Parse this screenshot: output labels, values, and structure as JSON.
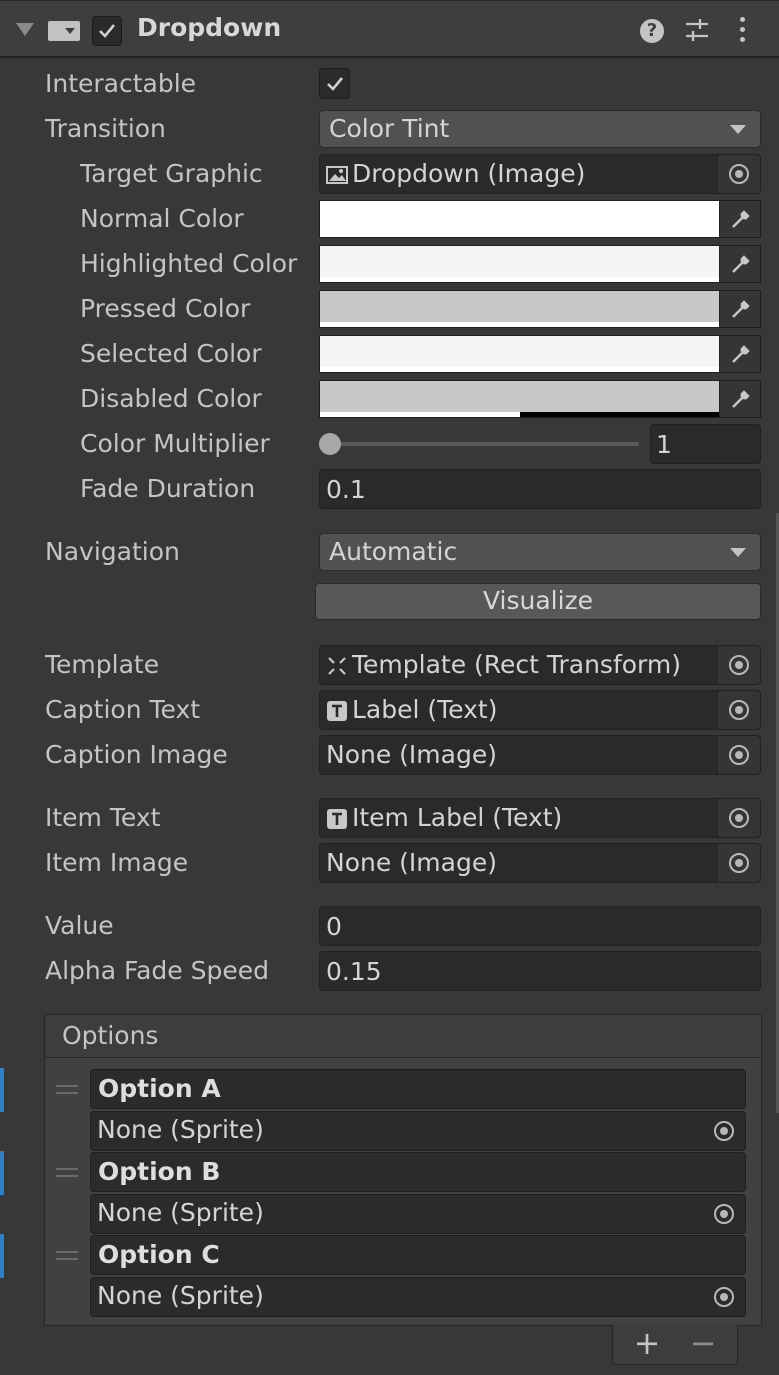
{
  "component": {
    "title": "Dropdown",
    "enabled": true,
    "help_glyph": "?"
  },
  "fields": {
    "interactable": {
      "label": "Interactable",
      "checked": true
    },
    "transition": {
      "label": "Transition",
      "value": "Color Tint"
    },
    "target_graphic": {
      "label": "Target Graphic",
      "value": "Dropdown (Image)"
    },
    "normal_color": {
      "label": "Normal Color",
      "color": "#ffffff"
    },
    "highlighted_color": {
      "label": "Highlighted Color",
      "color": "#f5f5f5"
    },
    "pressed_color": {
      "label": "Pressed Color",
      "color": "#c8c8c8"
    },
    "selected_color": {
      "label": "Selected Color",
      "color": "#f5f5f5"
    },
    "disabled_color": {
      "label": "Disabled Color",
      "color": "#c8c8c8",
      "alpha": 0.5
    },
    "color_multiplier": {
      "label": "Color Multiplier",
      "value": "1",
      "slider_fraction": 0.0
    },
    "fade_duration": {
      "label": "Fade Duration",
      "value": "0.1"
    },
    "navigation": {
      "label": "Navigation",
      "value": "Automatic"
    },
    "visualize": {
      "label": "Visualize"
    },
    "template": {
      "label": "Template",
      "value": "Template (Rect Transform)"
    },
    "caption_text": {
      "label": "Caption Text",
      "value": "Label (Text)"
    },
    "caption_image": {
      "label": "Caption Image",
      "value": "None (Image)"
    },
    "item_text": {
      "label": "Item Text",
      "value": "Item Label (Text)"
    },
    "item_image": {
      "label": "Item Image",
      "value": "None (Image)"
    },
    "value": {
      "label": "Value",
      "value": "0"
    },
    "alpha_fade_speed": {
      "label": "Alpha Fade Speed",
      "value": "0.15"
    }
  },
  "options": {
    "header": "Options",
    "items": [
      {
        "text": "Option A",
        "sprite": "None (Sprite)"
      },
      {
        "text": "Option B",
        "sprite": "None (Sprite)"
      },
      {
        "text": "Option C",
        "sprite": "None (Sprite)"
      }
    ],
    "add_label": "+",
    "remove_label": "−"
  },
  "icons": {
    "fold": "triangle-down-icon",
    "component": "dropdown-component-icon",
    "help": "help-icon",
    "presets": "presets-icon",
    "menu": "kebab-menu-icon",
    "picker": "object-picker-icon",
    "eyedropper": "eyedropper-icon"
  },
  "colors": {
    "selection_accent": "#2f80c4"
  }
}
